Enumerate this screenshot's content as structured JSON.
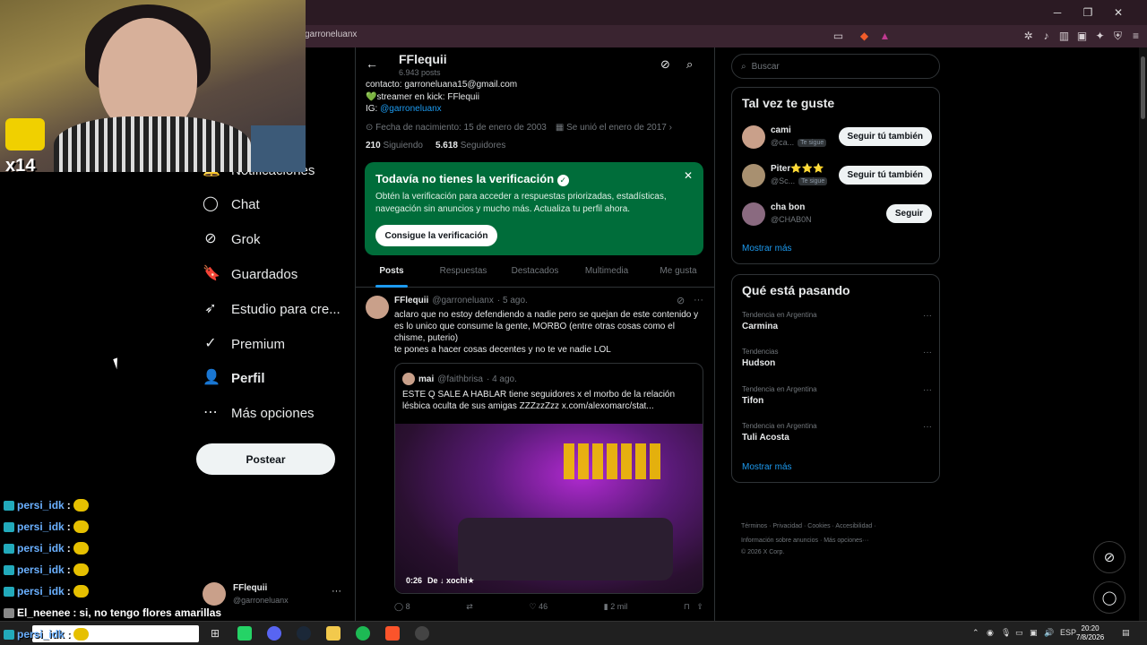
{
  "browser": {
    "url": "garroneluanx",
    "window_controls": [
      "─",
      "❐",
      "✕"
    ]
  },
  "overlay": {
    "combo": "x14",
    "chat": [
      {
        "user": "persi_idk",
        "msg": ""
      },
      {
        "user": "persi_idk",
        "msg": ""
      },
      {
        "user": "persi_idk",
        "msg": ""
      },
      {
        "user": "persi_idk",
        "msg": ""
      },
      {
        "user": "persi_idk",
        "msg": ""
      },
      {
        "user": "El_neenee",
        "msg": "si, no tengo flores amarillas"
      },
      {
        "user": "persi_idk",
        "msg": ""
      }
    ]
  },
  "nav": {
    "items": [
      {
        "label": "Notificaciones",
        "icon": "bell-icon"
      },
      {
        "label": "Chat",
        "icon": "chat-icon"
      },
      {
        "label": "Grok",
        "icon": "grok-icon"
      },
      {
        "label": "Guardados",
        "icon": "bookmark-icon"
      },
      {
        "label": "Estudio para cre...",
        "icon": "rocket-icon"
      },
      {
        "label": "Premium",
        "icon": "verified-icon"
      },
      {
        "label": "Perfil",
        "icon": "person-icon"
      },
      {
        "label": "Más opciones",
        "icon": "more-icon"
      }
    ],
    "post_button": "Postear",
    "account": {
      "name": "FFlequii",
      "handle": "@garroneluanx",
      "more": "···"
    }
  },
  "profile": {
    "name": "FFlequii",
    "post_count": "6.943 posts",
    "bio_lines": [
      "contacto: garroneluana15@gmail.com",
      "💚streamer en kick: FFlequii",
      "IG: "
    ],
    "ig_link": "@garroneluanx",
    "birthdate": "Fecha de nacimiento: 15 de enero de 2003",
    "joined": "Se unió el enero de 2017",
    "following_count": "210",
    "following_label": "Siguiendo",
    "followers_count": "5.618",
    "followers_label": "Seguidores"
  },
  "verification": {
    "title": "Todavía no tienes la verificación",
    "text": "Obtén la verificación para acceder a respuestas priorizadas, estadísticas, navegación sin anuncios y mucho más. Actualiza tu perfil ahora.",
    "button": "Consigue la verificación",
    "close": "✕"
  },
  "tabs": [
    "Posts",
    "Respuestas",
    "Destacados",
    "Multimedia",
    "Me gusta"
  ],
  "tweet": {
    "name": "FFlequii",
    "handle": "@garroneluanx",
    "time": "· 5 ago.",
    "text": "aclaro que no estoy defendiendo a nadie  pero se quejan de este contenido y es lo unico que consume la gente, MORBO (entre otras cosas como el chisme, puterio)\nte pones a hacer cosas decentes y no te ve nadie LOL",
    "quote": {
      "name": "mai",
      "handle": "@faithbrisa",
      "time": "· 4 ago.",
      "text": "ESTE Q SALE A HABLAR tiene seguidores x el morbo de la relación lésbica oculta de sus amigas ZZZzzZzz  x.com/alexomarc/stat...",
      "video_time": "0:26",
      "video_from": "De",
      "video_user": "xochi★"
    },
    "replies": "8",
    "likes": "46",
    "views": "2 mil"
  },
  "sidebar": {
    "search_placeholder": "Buscar",
    "suggestions_title": "Tal vez te guste",
    "suggestions": [
      {
        "name": "cami",
        "handle": "@ca...",
        "follows_you": "Te sigue",
        "button": "Seguir tú también"
      },
      {
        "name": "Piter⭐⭐⭐",
        "handle": "@Sc...",
        "follows_you": "Te sigue",
        "button": "Seguir tú también"
      },
      {
        "name": "cha bon",
        "handle": "@CHAB0N",
        "follows_you": "",
        "button": "Seguir"
      }
    ],
    "show_more": "Mostrar más",
    "trends_title": "Qué está pasando",
    "trends": [
      {
        "label": "Tendencia en Argentina",
        "name": "Carmina"
      },
      {
        "label": "Tendencias",
        "name": "Hudson"
      },
      {
        "label": "Tendencia en Argentina",
        "name": "Tifon"
      },
      {
        "label": "Tendencia en Argentina",
        "name": "Tuli Acosta"
      }
    ],
    "trends_more": "Mostrar más",
    "footer_line1": "Términos  ·  Privacidad  ·  Cookies  ·  Accesibilidad  ·",
    "footer_line2": "Información sobre anuncios  ·  Más opciones···",
    "footer_line3": "© 2026 X Corp."
  },
  "taskbar": {
    "lang": "ESP",
    "time": "20:20",
    "date": "7/8/2026"
  },
  "colors": {
    "accent": "#1d9bf0",
    "verify_bg": "#006d3a"
  }
}
